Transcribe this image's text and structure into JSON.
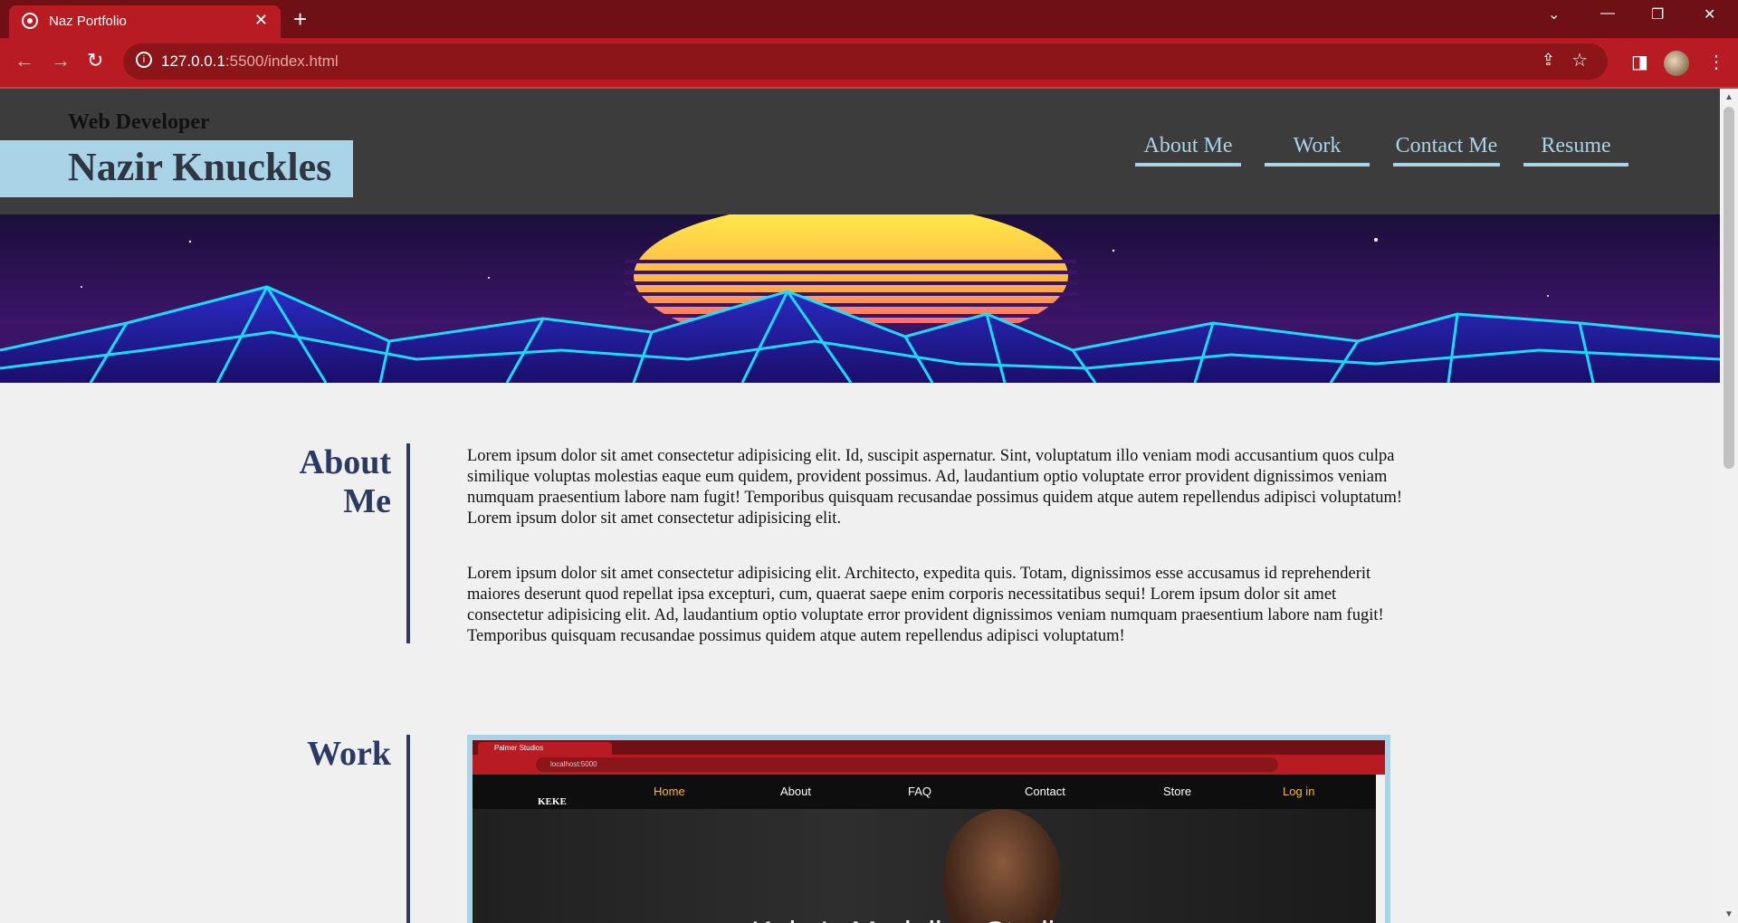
{
  "browser": {
    "tab_title": "Naz Portfolio",
    "tab_close": "✕",
    "new_tab": "+",
    "url_host": "127.0.0.1",
    "url_path": ":5500/index.html",
    "window_controls": [
      "⌄",
      "—",
      "❐",
      "✕"
    ]
  },
  "header": {
    "subtitle": "Web Developer",
    "name": "Nazir Knuckles",
    "nav": [
      "About Me",
      "Work",
      "Contact Me",
      "Resume"
    ]
  },
  "about": {
    "title_line1": "About",
    "title_line2": "Me",
    "paragraph1": "Lorem ipsum dolor sit amet consectetur adipisicing elit. Id, suscipit aspernatur. Sint, voluptatum illo veniam modi accusantium quos culpa similique voluptas molestias eaque eum quidem, provident possimus. Ad, laudantium optio voluptate error provident dignissimos veniam numquam praesentium labore nam fugit! Temporibus quisquam recusandae possimus quidem atque autem repellendus adipisci voluptatum! Lorem ipsum dolor sit amet consectetur adipisicing elit.",
    "paragraph2": "Lorem ipsum dolor sit amet consectetur adipisicing elit. Architecto, expedita quis. Totam, dignissimos esse accusamus id reprehenderit maiores deserunt quod repellat ipsa excepturi, cum, quaerat saepe enim corporis necessitatibus sequi! Lorem ipsum dolor sit amet consectetur adipisicing elit. Ad, laudantium optio voluptate error provident dignissimos veniam numquam praesentium labore nam fugit! Temporibus quisquam recusandae possimus quidem atque autem repellendus adipisci voluptatum!"
  },
  "work": {
    "title": "Work",
    "screenshot": {
      "tab_title": "Palmer Studios",
      "url": "localhost:5000",
      "logo_text": "KEKE",
      "nav": [
        "Home",
        "About",
        "FAQ",
        "Contact",
        "Store",
        "Log in"
      ],
      "hero_title": "Keke's Modeling Studio"
    }
  },
  "colors": {
    "accent": "#a9d3e6",
    "header_bg": "#3c3c3c",
    "section_title": "#2b3a63",
    "browser_red": "#b81c22",
    "active_nav": "#f5b82e"
  }
}
